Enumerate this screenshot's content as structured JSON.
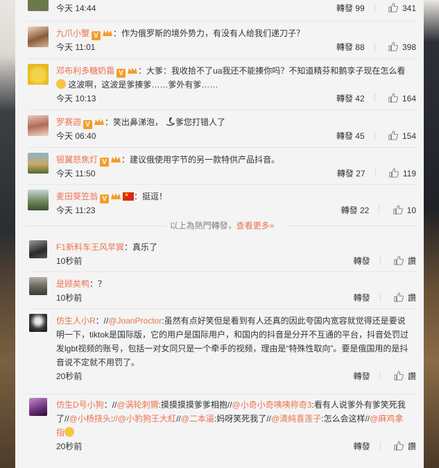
{
  "comments": [
    {
      "id": "c0",
      "user": "",
      "text": "",
      "time": "今天 14:44",
      "repost": "轉發 99",
      "likes": "341"
    },
    {
      "id": "c1",
      "user": "九爪小蟹",
      "text": "：作为俄罗斯的境外势力，有没有人给我们递刀子？",
      "time": "今天 11:01",
      "repost": "轉發 88",
      "likes": "398"
    },
    {
      "id": "c2",
      "user": "邓布利多糖奶霜",
      "text": "：大爹：我收拾不了ua我还不能揍你吗？不知道精芬和鹅孪子现在怎么看",
      "text2": "这波啊，这波是爹揍爹……爹外有爹……",
      "time": "今天 10:13",
      "repost": "轉發 42",
      "likes": "164"
    },
    {
      "id": "c3",
      "user": "罗赛迦",
      "text": "：笑出鼻涕泡，",
      "text_b": "爹您打错人了",
      "time": "今天 06:40",
      "repost": "轉發 45",
      "likes": "154"
    },
    {
      "id": "c4",
      "user": "银翼怒焦灯",
      "text": "：建议俄使用字节的另一款特供产品抖音。",
      "time": "今天 11:50",
      "repost": "轉發 27",
      "likes": "119"
    },
    {
      "id": "c5",
      "user": "麦田葵笠翁",
      "text": "：挺逗！",
      "time": "今天 11:23",
      "repost": "轉發 22",
      "likes": "10"
    },
    {
      "id": "c6",
      "user": "F1新料车王风早巽",
      "text": "：真乐了",
      "time": "10秒前",
      "repost": "轉發",
      "likes": "讚"
    },
    {
      "id": "c7",
      "user": "是顾矣鸭",
      "text": "：？",
      "time": "10秒前",
      "repost": "轉發",
      "likes": "讚"
    },
    {
      "id": "c8",
      "user": "仿生人小R",
      "l1_pre": "：//",
      "l1_link": "@JoanProctor",
      "l1_text": ":虽然有点好笑但是看到有人还真的因此夸国内宽容就觉得还是要说",
      "l2": "明一下，tiktok是国际版，它的用户是国际用户，和国内的抖音是分开不互通的平台，抖音处罚过",
      "l3": "发lgbt视频的账号，包括一对女同只是一个牵手的视频，理由是“特殊性取向”。要是俄国用的是抖",
      "l4": "音说不定就不用罚了。",
      "time": "20秒前",
      "repost": "轉發",
      "likes": "讚"
    },
    {
      "id": "c9",
      "user": "仿生D号小狗",
      "l1_pre": "：//",
      "l1_link": "@涡轮刺猬",
      "l1_text": ":摸摸摸摸爹爹相抱//",
      "l1_link2": "@小奇小奇咦咦称奇3",
      "l1_text2": ":看有人说爹外有爹笑死我",
      "l2_pre": "了//",
      "l2_link": "@小杨挠头",
      "l2_t": ":",
      "l2_link2": "//@小豹狗王大紅",
      "l2_t2": "//",
      "l2_link3": "@二本逼",
      "l2_t3": ":妈呀笑死我了//",
      "l2_link4": "@清純喜莲子",
      "l2_t4": ":怎么会这样//",
      "l2_link5": "@麻鸡拿",
      "l3_link": "指",
      "time": "20秒前",
      "repost": "轉發",
      "likes": "讚"
    }
  ],
  "hot_divider": {
    "text": "以上為熱門轉發，",
    "more": "查看更多»"
  },
  "colors": {
    "accent": "#eb7350",
    "vip_badge": "#f59d2a",
    "background": "#f4f4f4"
  }
}
